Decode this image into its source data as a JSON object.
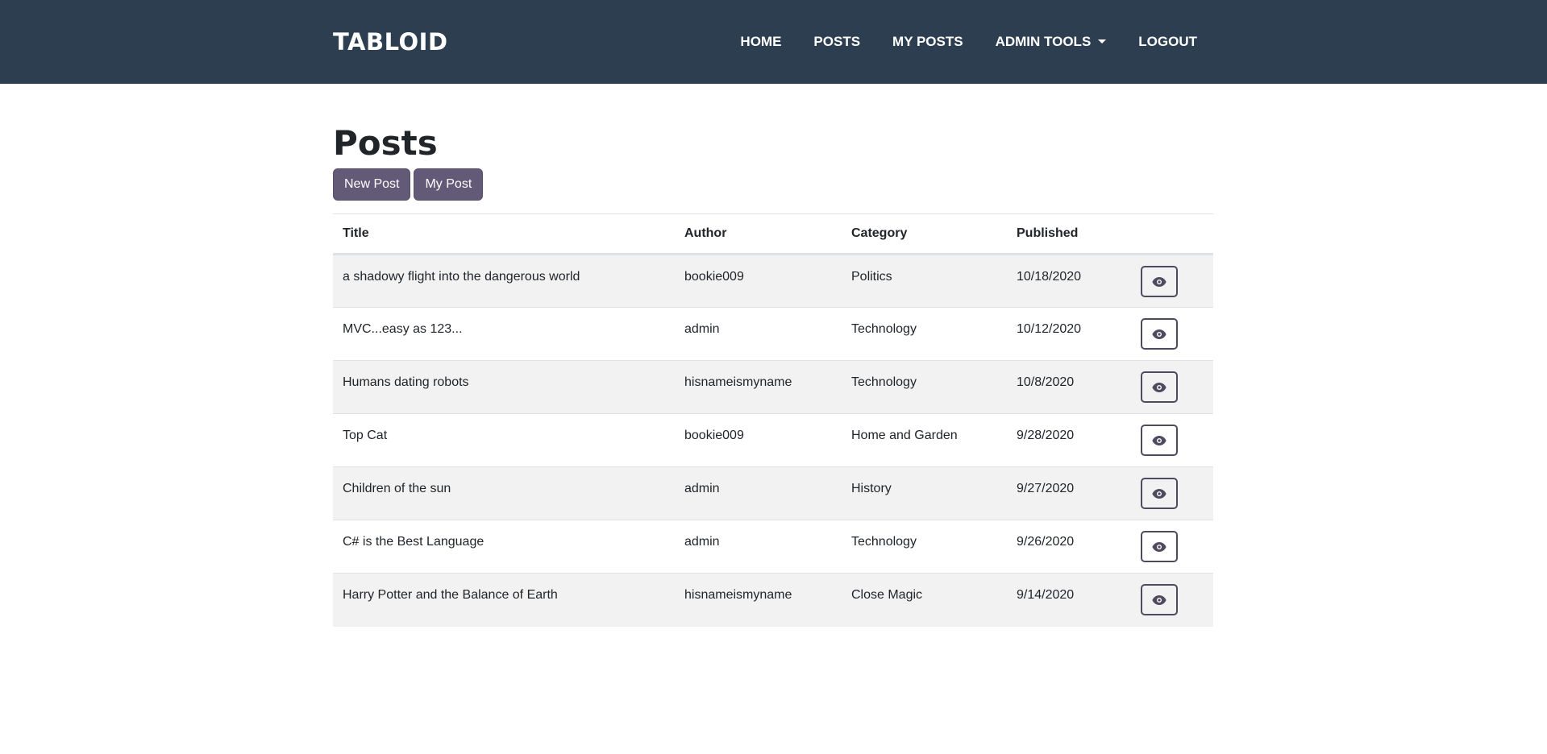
{
  "navbar": {
    "brand": "TABLOID",
    "links": [
      {
        "label": "HOME"
      },
      {
        "label": "POSTS"
      },
      {
        "label": "MY POSTS"
      },
      {
        "label": "ADMIN TOOLS"
      },
      {
        "label": "LOGOUT"
      }
    ]
  },
  "main": {
    "title": "Posts",
    "buttons": {
      "new_post": "New Post",
      "my_post": "My Post"
    },
    "table": {
      "headers": {
        "title": "Title",
        "author": "Author",
        "category": "Category",
        "published": "Published"
      },
      "rows": [
        {
          "title": "a shadowy flight into the dangerous world",
          "author": "bookie009",
          "category": "Politics",
          "published": "10/18/2020"
        },
        {
          "title": "MVC...easy as 123...",
          "author": "admin",
          "category": "Technology",
          "published": "10/12/2020"
        },
        {
          "title": "Humans dating robots",
          "author": "hisnameismyname",
          "category": "Technology",
          "published": "10/8/2020"
        },
        {
          "title": "Top Cat",
          "author": "bookie009",
          "category": "Home and Garden",
          "published": "9/28/2020"
        },
        {
          "title": "Children of the sun",
          "author": "admin",
          "category": "History",
          "published": "9/27/2020"
        },
        {
          "title": "C# is the Best Language",
          "author": "admin",
          "category": "Technology",
          "published": "9/26/2020"
        },
        {
          "title": "Harry Potter and the Balance of Earth",
          "author": "hisnameismyname",
          "category": "Close Magic",
          "published": "9/14/2020"
        }
      ],
      "row_action_icon": "eye-icon"
    }
  },
  "colors": {
    "navbar_bg": "#2c3e50",
    "button_bg": "#635a78",
    "row_stripe": "#f2f2f2"
  }
}
